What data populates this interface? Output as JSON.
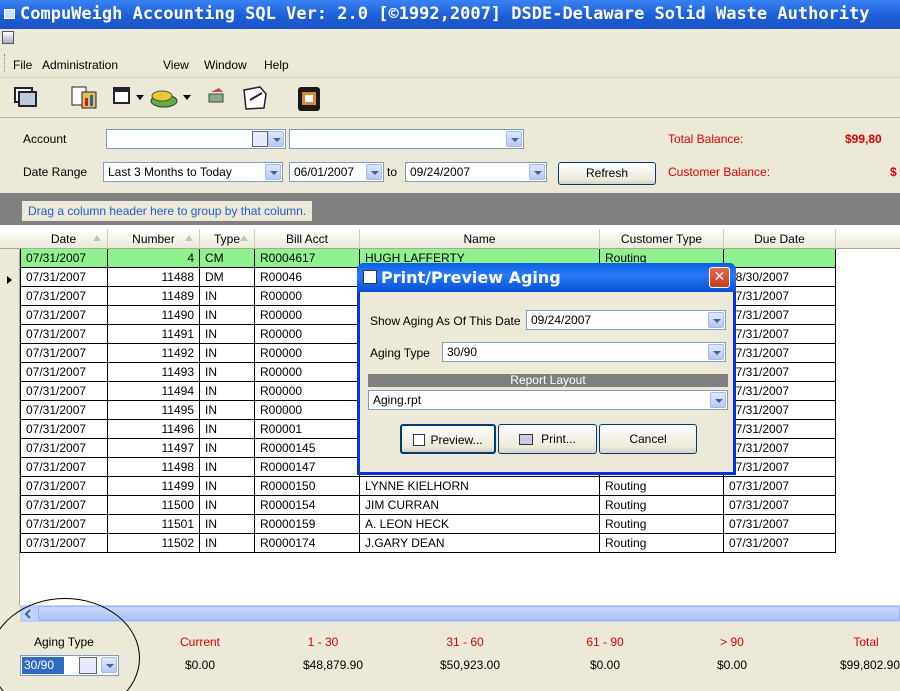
{
  "window": {
    "title": "CompuWeigh Accounting SQL Ver: 2.0 [©1992,2007]  DSDE-Delaware Solid Waste Authority"
  },
  "menu": {
    "file": "File",
    "administration": "Administration",
    "view": "View",
    "window": "Window",
    "help": "Help"
  },
  "filters": {
    "account_label": "Account",
    "account_value": "",
    "account_name_value": "",
    "date_range_label": "Date Range",
    "date_range_value": "Last 3 Months to Today",
    "from_date": "06/01/2007",
    "to_label": "to",
    "to_date": "09/24/2007",
    "refresh_label": "Refresh",
    "total_balance_label": "Total Balance:",
    "total_balance_value": "$99,80",
    "customer_balance_label": "Customer Balance:",
    "customer_balance_value": "$"
  },
  "grid": {
    "group_hint": "Drag a column header here to group by that column.",
    "columns": [
      "Date",
      "Number",
      "Type",
      "Bill Acct",
      "Name",
      "Customer Type",
      "Due Date"
    ],
    "rows": [
      {
        "date": "07/31/2007",
        "number": "4",
        "type": "CM",
        "bill": "R0004617",
        "name": "HUGH LAFFERTY",
        "ctype": "Routing",
        "due": ""
      },
      {
        "date": "07/31/2007",
        "number": "11488",
        "type": "DM",
        "bill": "R00046",
        "name": "",
        "ctype": "",
        "due": "08/30/2007"
      },
      {
        "date": "07/31/2007",
        "number": "11489",
        "type": "IN",
        "bill": "R00000",
        "name": "",
        "ctype": "",
        "due": "07/31/2007"
      },
      {
        "date": "07/31/2007",
        "number": "11490",
        "type": "IN",
        "bill": "R00000",
        "name": "",
        "ctype": "",
        "due": "07/31/2007"
      },
      {
        "date": "07/31/2007",
        "number": "11491",
        "type": "IN",
        "bill": "R00000",
        "name": "",
        "ctype": "",
        "due": "07/31/2007"
      },
      {
        "date": "07/31/2007",
        "number": "11492",
        "type": "IN",
        "bill": "R00000",
        "name": "",
        "ctype": "",
        "due": "07/31/2007"
      },
      {
        "date": "07/31/2007",
        "number": "11493",
        "type": "IN",
        "bill": "R00000",
        "name": "",
        "ctype": "",
        "due": "07/31/2007"
      },
      {
        "date": "07/31/2007",
        "number": "11494",
        "type": "IN",
        "bill": "R00000",
        "name": "",
        "ctype": "",
        "due": "07/31/2007"
      },
      {
        "date": "07/31/2007",
        "number": "11495",
        "type": "IN",
        "bill": "R00000",
        "name": "",
        "ctype": "",
        "due": "07/31/2007"
      },
      {
        "date": "07/31/2007",
        "number": "11496",
        "type": "IN",
        "bill": "R00001",
        "name": "",
        "ctype": "",
        "due": "07/31/2007"
      },
      {
        "date": "07/31/2007",
        "number": "11497",
        "type": "IN",
        "bill": "R0000145",
        "name": "GLENN GROSS",
        "ctype": "Routing",
        "due": "07/31/2007"
      },
      {
        "date": "07/31/2007",
        "number": "11498",
        "type": "IN",
        "bill": "R0000147",
        "name": "RENEE VALLEE",
        "ctype": "Routing",
        "due": "07/31/2007"
      },
      {
        "date": "07/31/2007",
        "number": "11499",
        "type": "IN",
        "bill": "R0000150",
        "name": "LYNNE KIELHORN",
        "ctype": "Routing",
        "due": "07/31/2007"
      },
      {
        "date": "07/31/2007",
        "number": "11500",
        "type": "IN",
        "bill": "R0000154",
        "name": "JIM CURRAN",
        "ctype": "Routing",
        "due": "07/31/2007"
      },
      {
        "date": "07/31/2007",
        "number": "11501",
        "type": "IN",
        "bill": "R0000159",
        "name": "A. LEON HECK",
        "ctype": "Routing",
        "due": "07/31/2007"
      },
      {
        "date": "07/31/2007",
        "number": "11502",
        "type": "IN",
        "bill": "R0000174",
        "name": "J.GARY DEAN",
        "ctype": "Routing",
        "due": "07/31/2007"
      }
    ]
  },
  "summary": {
    "aging_type_label": "Aging Type",
    "aging_type_value": "30/90",
    "headers": [
      "Current",
      "1 - 30",
      "31 - 60",
      "61 - 90",
      "> 90",
      "Total"
    ],
    "values": [
      "$0.00",
      "$48,879.90",
      "$50,923.00",
      "$0.00",
      "$0.00",
      "$99,802.90"
    ]
  },
  "dialog": {
    "title": "Print/Preview Aging",
    "show_aging_label": "Show Aging As Of This Date",
    "show_aging_value": "09/24/2007",
    "aging_type_label": "Aging Type",
    "aging_type_value": "30/90",
    "report_layout_label": "Report Layout",
    "report_layout_value": "Aging.rpt",
    "preview_label": "Preview...",
    "print_label": "Print...",
    "cancel_label": "Cancel"
  },
  "colors": {
    "title_blue": "#1d5ed6",
    "accent_red": "#e00000",
    "selected_row": "#8ff28f",
    "group_hint_blue": "#2060d0"
  }
}
